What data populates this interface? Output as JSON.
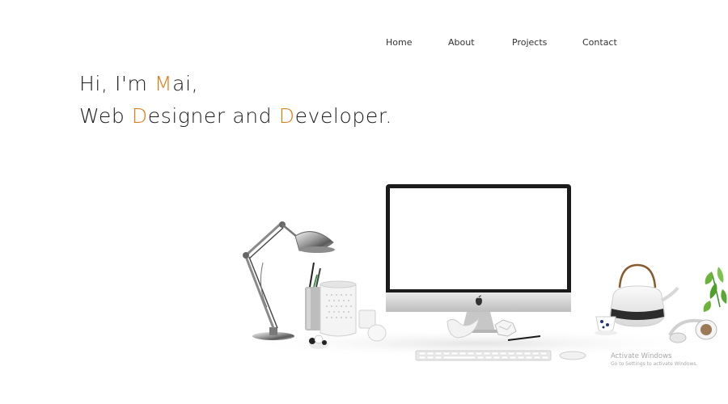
{
  "nav": {
    "items": [
      {
        "label": "Home"
      },
      {
        "label": "About"
      },
      {
        "label": "Projects"
      },
      {
        "label": "Contact"
      }
    ]
  },
  "hero": {
    "line1": {
      "pre": "Hi, I'm ",
      "accent": "M",
      "post": "ai,"
    },
    "line2": {
      "pre": "Web ",
      "accent1": "D",
      "mid": "esigner and ",
      "accent2": "D",
      "post": "eveloper."
    }
  },
  "colors": {
    "accent": "#e07b14",
    "text": "#1d1d1d",
    "background": "#ffffff"
  },
  "watermark": {
    "title": "Activate Windows",
    "subtitle": "Go to Settings to activate Windows."
  },
  "scene": {
    "objects": [
      "desk-lamp",
      "pencil-holder",
      "candle-holder",
      "imac",
      "apple-logo",
      "keyboard",
      "mouse",
      "teapot",
      "teacup",
      "headphones",
      "plant",
      "bird-figurine",
      "panda-figurine",
      "egg-figurine",
      "pen",
      "crumpled-paper"
    ]
  }
}
